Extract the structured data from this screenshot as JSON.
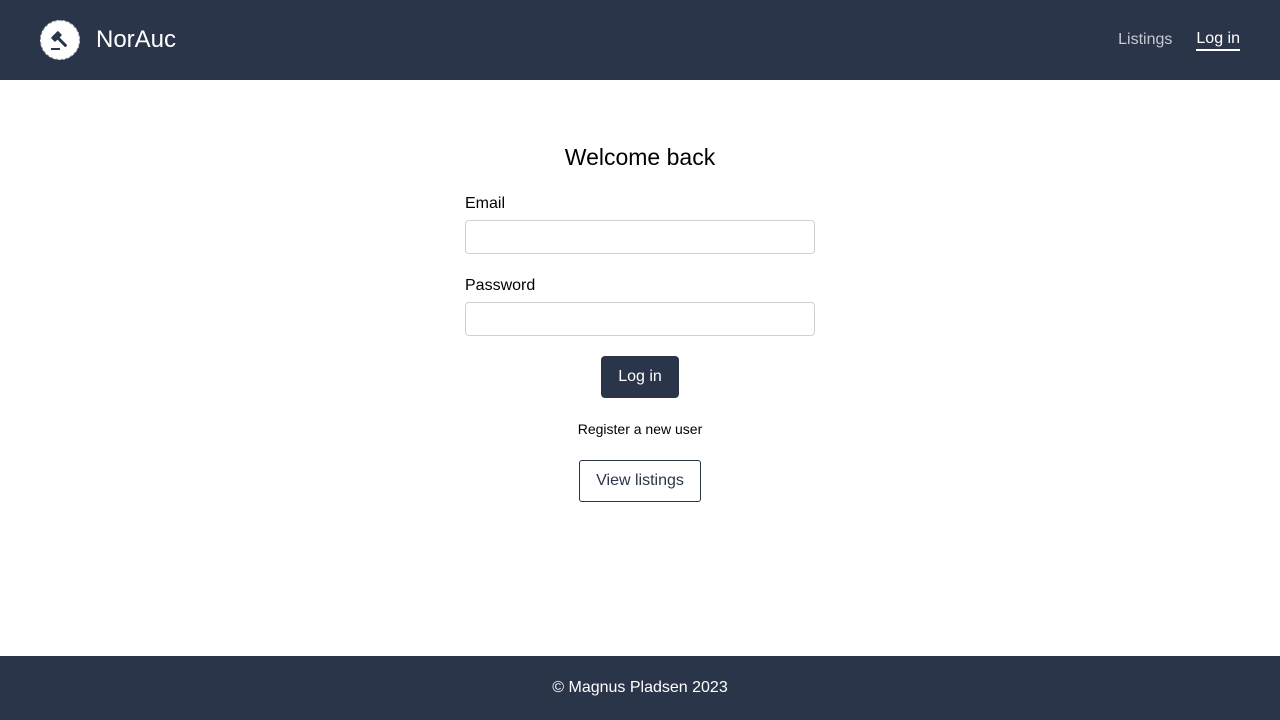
{
  "colors": {
    "primary": "#2b3549",
    "nav_link_inactive": "#c5cad3",
    "background": "#ffffff"
  },
  "header": {
    "logo_icon": "gavel-icon",
    "brand": "NorAuc",
    "nav": [
      {
        "label": "Listings",
        "active": false
      },
      {
        "label": "Log in",
        "active": true
      }
    ]
  },
  "login_form": {
    "heading": "Welcome back",
    "email": {
      "label": "Email",
      "value": "",
      "placeholder": ""
    },
    "password": {
      "label": "Password",
      "value": "",
      "placeholder": ""
    },
    "submit_label": "Log in",
    "register_link": "Register a new user",
    "view_listings_label": "View listings"
  },
  "footer": {
    "text": "© Magnus Pladsen 2023"
  }
}
